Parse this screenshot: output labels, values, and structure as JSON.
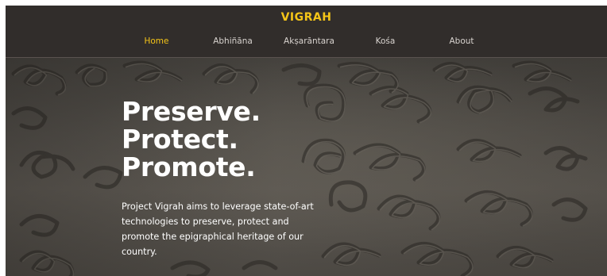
{
  "header": {
    "brand": "VIGRAH",
    "nav": [
      {
        "label": "Home",
        "active": true
      },
      {
        "label": "Abhiñāna",
        "active": false
      },
      {
        "label": "Akṣarāntara",
        "active": false
      },
      {
        "label": "Kośa",
        "active": false
      },
      {
        "label": "About",
        "active": false
      }
    ]
  },
  "hero": {
    "headline": [
      "Preserve.",
      "Protect.",
      "Promote."
    ],
    "description": "Project Vigrah aims to leverage state-of-art technologies to preserve, protect and promote the epigraphical heritage of our country."
  },
  "colors": {
    "header_bg": "#312d2b",
    "accent": "#f5c518",
    "nav_text": "#d8d3cf",
    "hero_text": "#ffffff"
  }
}
